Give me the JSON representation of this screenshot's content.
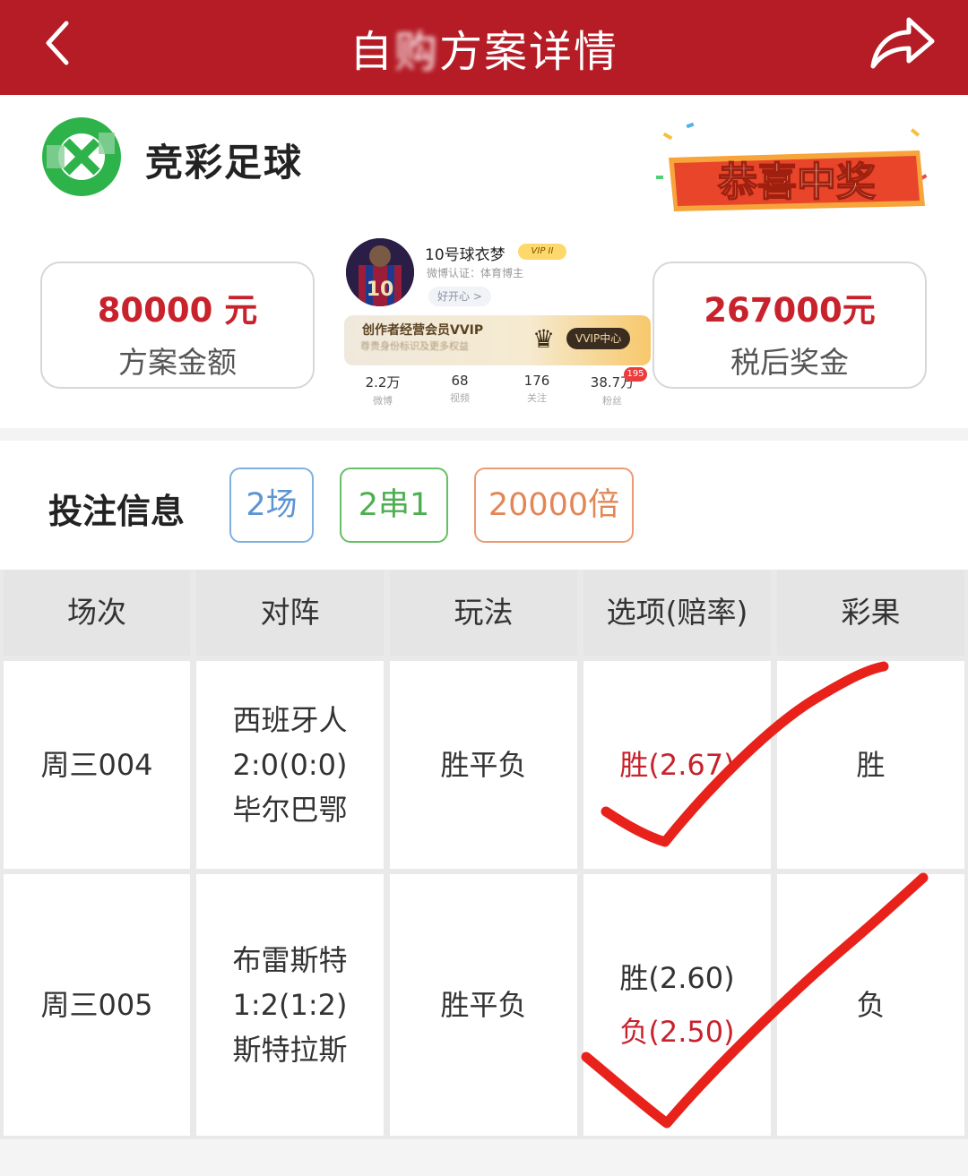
{
  "header": {
    "title_visible": "自",
    "title_blurred": "购",
    "title_rest": "方案详情"
  },
  "brand": {
    "name": "竞彩足球",
    "banner_text": "恭喜中奖"
  },
  "amounts": {
    "plan": {
      "value": "80000 元",
      "label": "方案金额"
    },
    "prize": {
      "value": "267000元",
      "label": "税后奖金"
    }
  },
  "profile": {
    "name": "10号球衣梦",
    "vip_level": "VIP II",
    "verification": "微博认证：体育博主",
    "mood": "好开心 >",
    "jersey_number": "10",
    "vip_banner": {
      "title": "创作者经营会员VVIP",
      "subtitle": "尊贵身份标识及更多权益",
      "button": "VVIP中心"
    },
    "stats": [
      {
        "value": "2.2万",
        "label": "微博"
      },
      {
        "value": "68",
        "label": "视频"
      },
      {
        "value": "176",
        "label": "关注"
      },
      {
        "value": "38.7万",
        "label": "粉丝"
      }
    ],
    "notification_count": "195"
  },
  "bet_info": {
    "title": "投注信息",
    "tags": [
      "2场",
      "2串1",
      "20000倍"
    ]
  },
  "table": {
    "headers": [
      "场次",
      "对阵",
      "玩法",
      "选项(赔率)",
      "彩果"
    ],
    "rows": [
      {
        "match_no": "周三004",
        "home": "西班牙人",
        "score": "2:0(0:0)",
        "away": "毕尔巴鄂",
        "play": "胜平负",
        "options": [
          {
            "text": "胜(2.67)",
            "hit": true
          }
        ],
        "result": "胜"
      },
      {
        "match_no": "周三005",
        "home": "布雷斯特",
        "score": "1:2(1:2)",
        "away": "斯特拉斯",
        "play": "胜平负",
        "options": [
          {
            "text": "胜(2.60)",
            "hit": false
          },
          {
            "text": "负(2.50)",
            "hit": true
          }
        ],
        "result": "负"
      }
    ]
  },
  "colors": {
    "header_red": "#b51c26",
    "accent_red": "#c8222d",
    "tag_blue": "#5d95d2",
    "tag_green": "#4caf50",
    "tag_orange": "#e38656",
    "check_red": "#e8211b"
  }
}
